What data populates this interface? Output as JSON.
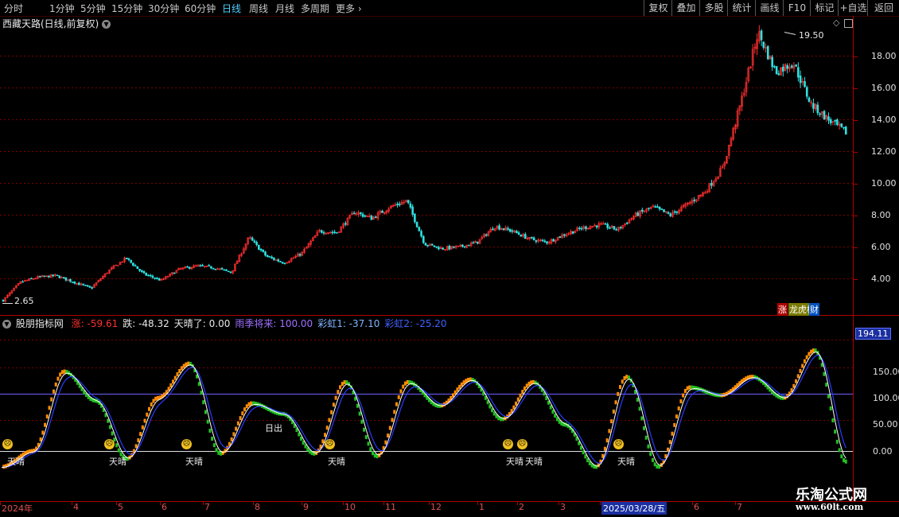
{
  "toolbar": {
    "left_items": [
      "分时",
      "1分钟",
      "5分钟",
      "15分钟",
      "30分钟",
      "60分钟",
      "日线",
      "周线",
      "月线",
      "多周期",
      "更多"
    ],
    "active": "日线",
    "right_items": [
      "复权",
      "叠加",
      "多股",
      "统计",
      "画线",
      "F10",
      "标记",
      "+自选",
      "返回"
    ]
  },
  "stock": {
    "title": "西藏天路(日线,前复权)",
    "high_label": "19.50",
    "low_label": "2.65"
  },
  "price_axis": {
    "ticks": [
      "18.00",
      "16.00",
      "14.00",
      "12.00",
      "10.00",
      "8.00",
      "6.00",
      "4.00"
    ]
  },
  "icons": {
    "menu": "chevron-down-icon",
    "corner_left": "diamond-icon",
    "corner_right": "window-icon",
    "badge_zhang": "涨",
    "badge_bang": "龙虎榜",
    "badge_cai": "财"
  },
  "indicator": {
    "name": "股朋指标网",
    "legend": [
      {
        "label": "涨:",
        "value": "-59.61",
        "color": "#ff3030"
      },
      {
        "label": "跌:",
        "value": "-48.32",
        "color": "#e8e8e8"
      },
      {
        "label": "天晴了:",
        "value": "0.00",
        "color": "#e8e8e8"
      },
      {
        "label": "雨季将来:",
        "value": "100.00",
        "color": "#a070ff"
      },
      {
        "label": "彩虹1:",
        "value": "-37.10",
        "color": "#7fb5ff"
      },
      {
        "label": "彩虹2:",
        "value": "-25.20",
        "color": "#4060ff"
      }
    ],
    "axis_ticks": [
      "150.00",
      "100.00",
      "50.00",
      "0.00"
    ],
    "current_value": "194.11",
    "signal_labels": [
      "天晴",
      "天晴",
      "天晴",
      "日出",
      "天晴",
      "天晴",
      "天晴",
      "天晴"
    ]
  },
  "date_axis": {
    "labels": [
      "2024年",
      "4",
      "5",
      "6",
      "7",
      "8",
      "9",
      "10",
      "11",
      "12",
      "1",
      "2",
      "3",
      "2025/03/28/五",
      "6",
      "7"
    ]
  },
  "watermark": {
    "title": "乐淘公式网",
    "url": "www.60lt.com"
  },
  "colors": {
    "up": "#ff3030",
    "down": "#30e0e0",
    "grid": "#7a0000",
    "osc_up": "#ff8c00",
    "osc_down": "#22c022",
    "line_white": "#ffffff",
    "line_blue": "#2a3cff",
    "line_purple": "#7060ff"
  },
  "chart_data": [
    {
      "type": "candlestick",
      "title": "西藏天路(日线,前复权)",
      "y_range": [
        2.5,
        20.0
      ],
      "x_period": [
        "2024年",
        "2025/7"
      ],
      "series_close_approx": [
        2.65,
        3.8,
        4.1,
        4.2,
        3.8,
        3.4,
        4.5,
        5.3,
        4.3,
        3.9,
        4.6,
        4.8,
        4.7,
        4.4,
        6.6,
        5.4,
        5.0,
        5.6,
        7.0,
        6.9,
        8.2,
        7.8,
        8.5,
        8.9,
        6.2,
        5.9,
        6.0,
        6.3,
        7.3,
        7.0,
        6.5,
        6.3,
        6.8,
        7.2,
        7.4,
        7.1,
        8.0,
        8.5,
        8.0,
        8.7,
        9.5,
        11.0,
        15.0,
        19.5,
        17.0,
        17.6,
        15.0,
        14.0,
        13.2
      ],
      "high": 19.5,
      "low": 2.65
    },
    {
      "type": "line",
      "title": "股朋指标网",
      "y_range": [
        -45,
        200
      ],
      "series": [
        {
          "name": "涨",
          "values": [
            -30,
            0,
            150,
            95,
            -15,
            100,
            165,
            -5,
            90,
            70,
            -5,
            130,
            -10,
            130,
            85,
            135,
            60,
            130,
            50,
            -30,
            140,
            -30,
            120,
            105,
            140,
            100,
            190,
            -20
          ]
        },
        {
          "name": "雨季将来",
          "values": [
            100,
            100,
            100,
            100,
            100,
            100,
            100,
            100,
            100,
            100,
            100,
            100,
            100,
            100,
            100,
            100,
            100,
            100,
            100,
            100,
            100,
            100,
            100,
            100,
            100,
            100,
            100,
            100
          ]
        },
        {
          "name": "天晴了",
          "values": [
            0,
            0,
            0,
            0,
            0,
            0,
            0,
            0,
            0,
            0,
            0,
            0,
            0,
            0,
            0,
            0,
            0,
            0,
            0,
            0,
            0,
            0,
            0,
            0,
            0,
            0,
            0,
            0
          ]
        }
      ]
    }
  ]
}
